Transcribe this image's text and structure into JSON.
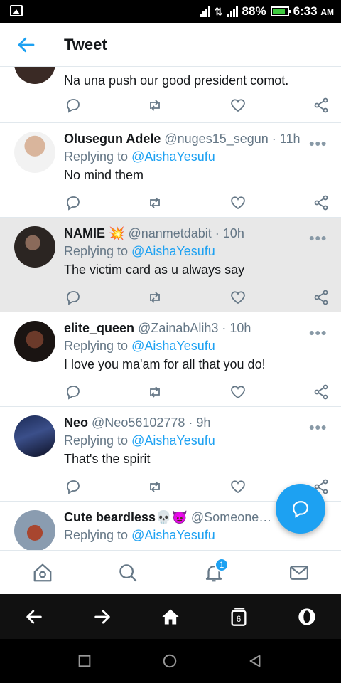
{
  "status": {
    "battery": "88%",
    "time": "6:33",
    "ampm": "AM"
  },
  "header": {
    "title": "Tweet"
  },
  "first_reply": {
    "text": "Na una push our good president comot."
  },
  "replies": [
    {
      "name": "Olusegun Adele",
      "handle": "@nuges15_segun",
      "time": "11h",
      "replying_label": "Replying to",
      "replying_to": "@AishaYesufu",
      "text": "No mind them"
    },
    {
      "name": "NAMIE",
      "emoji": "💥",
      "handle": "@nanmetdabit",
      "time": "10h",
      "replying_label": "Replying to",
      "replying_to": "@AishaYesufu",
      "text": "The victim card as u always say"
    },
    {
      "name": "elite_queen",
      "handle": "@ZainabAlih3",
      "time": "10h",
      "replying_label": "Replying to",
      "replying_to": "@AishaYesufu",
      "text": "I love you ma'am for all that you do!"
    },
    {
      "name": "Neo",
      "handle": "@Neo56102778",
      "time": "9h",
      "replying_label": "Replying to",
      "replying_to": "@AishaYesufu",
      "text": "That's the spirit"
    },
    {
      "name": "Cute beardless",
      "emoji": "💀😈",
      "handle": "@Someone…",
      "replying_label": "Replying to",
      "replying_to": "@AishaYesufu"
    }
  ],
  "tabbar": {
    "notifications_badge": "1"
  },
  "browser": {
    "tabs_count": "6"
  },
  "colors": {
    "accent": "#1da1f2",
    "text": "#14171a",
    "muted": "#657786"
  }
}
